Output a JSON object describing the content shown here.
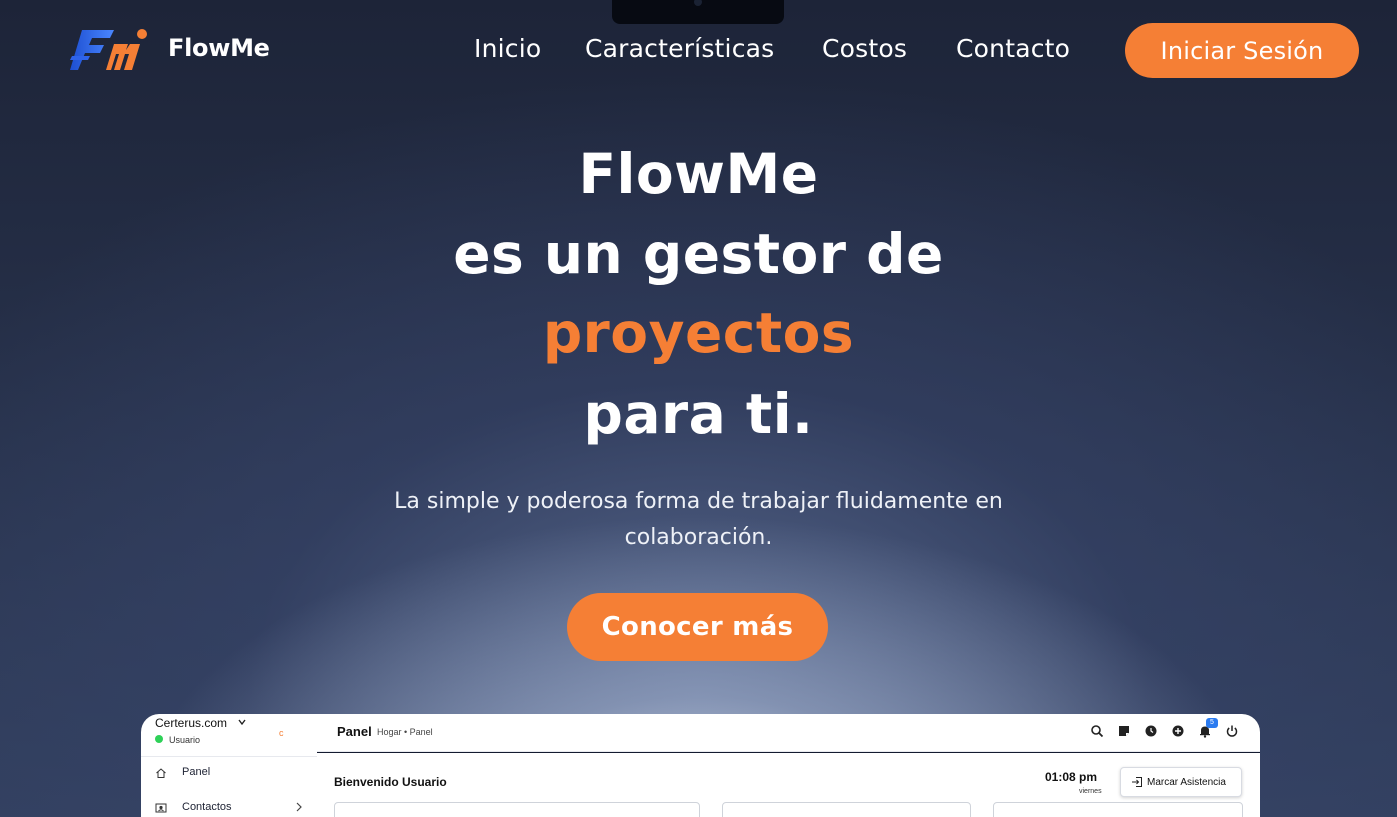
{
  "brand": {
    "name": "FlowMe",
    "logo_icon": "fm-logo-icon"
  },
  "nav": {
    "links": [
      "Inicio",
      "Características",
      "Costos",
      "Contacto"
    ],
    "login_label": "Iniciar Sesión"
  },
  "hero": {
    "line1": "FlowMe",
    "line2": "es un gestor de",
    "line3": "proyectos",
    "line4": "para ti.",
    "subtitle": "La simple y poderosa forma de trabajar fluidamente en colaboración.",
    "cta_label": "Conocer más"
  },
  "preview": {
    "org_name": "Certerus.com",
    "status_label": "Usuario",
    "collapse_badge": "c",
    "sidebar_items": [
      {
        "label": "Panel",
        "icon": "home-icon"
      },
      {
        "label": "Contactos",
        "icon": "contacts-icon"
      }
    ],
    "page_title": "Panel",
    "breadcrumb": "Hogar • Panel",
    "notification_count": "5",
    "welcome": "Bienvenido Usuario",
    "time": "01:08 pm",
    "weekday": "viernes",
    "attendance_label": "Marcar Asistencia"
  },
  "colors": {
    "accent": "#f57f35",
    "background": "#1b2338",
    "online": "#2ed158"
  }
}
